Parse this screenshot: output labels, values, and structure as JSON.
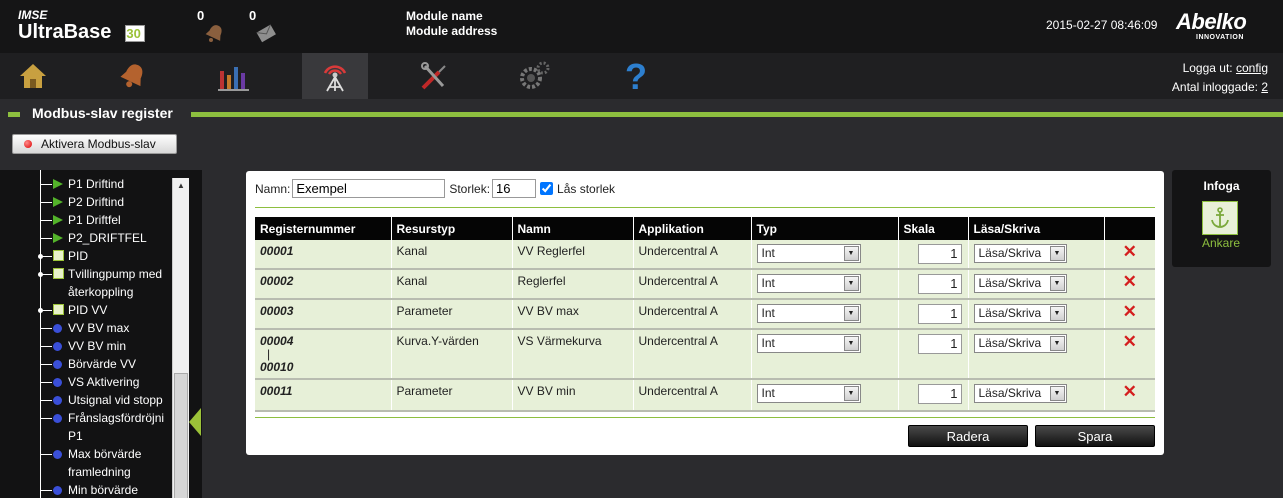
{
  "header": {
    "brand_small": "IMSE",
    "brand_big": "UltraBase",
    "brand_num": "30",
    "alarm_count": "0",
    "message_count": "0",
    "module_name": "Module name",
    "module_address": "Module address",
    "datetime": "2015-02-27 08:46:09",
    "logo_name": "Abelko",
    "logo_sub": "INNOVATION"
  },
  "nav": {
    "items": [
      "home-icon",
      "alarm-bell-icon",
      "bar-chart-icon",
      "antenna-icon",
      "tools-icon",
      "gears-icon",
      "help-icon"
    ],
    "active": "antenna-icon",
    "logout_label": "Logga ut:",
    "logout_user": "config",
    "logged_in_label": "Antal inloggade:",
    "logged_in_count": "2"
  },
  "section": {
    "title": "Modbus-slav register",
    "activate_button": "Aktivera Modbus-slav"
  },
  "tree": {
    "items": [
      {
        "label": "P1 Driftind",
        "type": "play"
      },
      {
        "label": "P2 Driftind",
        "type": "play"
      },
      {
        "label": "P1 Driftfel",
        "type": "play"
      },
      {
        "label": "P2_DRIFTFEL",
        "type": "play"
      },
      {
        "label": "PID",
        "type": "box"
      },
      {
        "label": "Tvillingpump med",
        "type": "box"
      },
      {
        "label": "återkoppling",
        "type": "cont"
      },
      {
        "label": "PID VV",
        "type": "box"
      },
      {
        "label": "VV BV max",
        "type": "dot"
      },
      {
        "label": "VV BV min",
        "type": "dot"
      },
      {
        "label": "Börvärde VV",
        "type": "dot"
      },
      {
        "label": "VS Aktivering",
        "type": "dot"
      },
      {
        "label": "Utsignal vid stopp",
        "type": "dot"
      },
      {
        "label": "Frånslagsfördröjni",
        "type": "dot"
      },
      {
        "label": "P1",
        "type": "cont"
      },
      {
        "label": "Max börvärde",
        "type": "dot"
      },
      {
        "label": "framledning",
        "type": "cont"
      },
      {
        "label": "Min börvärde",
        "type": "dot"
      }
    ]
  },
  "form": {
    "name_label": "Namn:",
    "name_value": "Exempel",
    "size_label": "Storlek:",
    "size_value": "16",
    "lock_label": "Lås storlek",
    "lock_checked": true
  },
  "table": {
    "headers": [
      "Registernummer",
      "Resurstyp",
      "Namn",
      "Applikation",
      "Typ",
      "Skala",
      "Läsa/Skriva",
      ""
    ],
    "rows": [
      {
        "reg": "00001",
        "reg_end": "",
        "resurs": "Kanal",
        "namn": "VV Reglerfel",
        "app": "Undercentral A",
        "typ": "Int",
        "skala": "1",
        "rw": "Läsa/Skriva"
      },
      {
        "reg": "00002",
        "reg_end": "",
        "resurs": "Kanal",
        "namn": "Reglerfel",
        "app": "Undercentral A",
        "typ": "Int",
        "skala": "1",
        "rw": "Läsa/Skriva"
      },
      {
        "reg": "00003",
        "reg_end": "",
        "resurs": "Parameter",
        "namn": "VV BV max",
        "app": "Undercentral A",
        "typ": "Int",
        "skala": "1",
        "rw": "Läsa/Skriva"
      },
      {
        "reg": "00004",
        "reg_end": "00010",
        "resurs": "Kurva.Y-värden",
        "namn": "VS Värmekurva",
        "app": "Undercentral A",
        "typ": "Int",
        "skala": "1",
        "rw": "Läsa/Skriva"
      },
      {
        "reg": "00011",
        "reg_end": "",
        "resurs": "Parameter",
        "namn": "VV BV min",
        "app": "Undercentral A",
        "typ": "Int",
        "skala": "1",
        "rw": "Läsa/Skriva"
      }
    ]
  },
  "buttons": {
    "delete": "Radera",
    "save": "Spara"
  },
  "infoga": {
    "title": "Infoga",
    "anchor_label": "Ankare"
  },
  "colors": {
    "accent": "#8dbf3f",
    "row_bg": "#e7f0d8",
    "delete": "#d41e1e"
  }
}
